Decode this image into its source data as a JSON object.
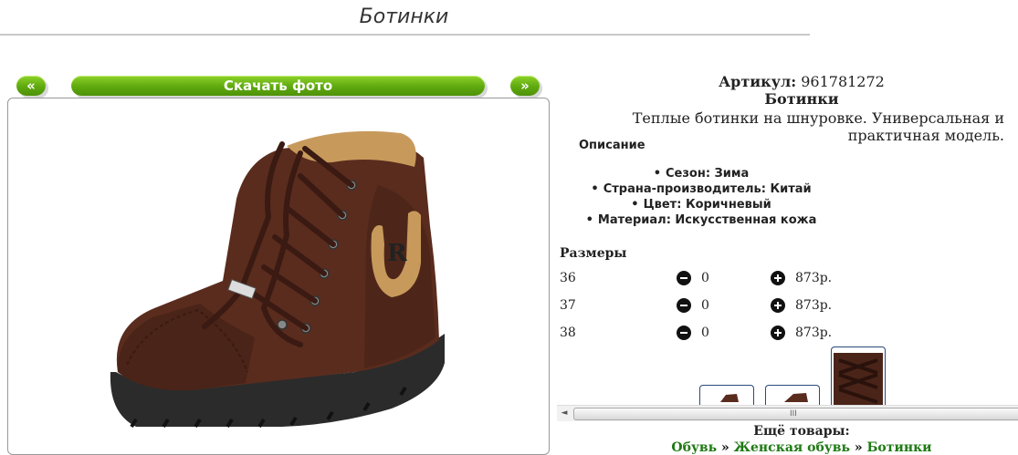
{
  "page": {
    "title": "Ботинки"
  },
  "gallery": {
    "prev_label": "«",
    "download_label": "Скачать фото",
    "next_label": "»"
  },
  "product": {
    "article_label": "Артикул:",
    "article_value": "961781272",
    "name": "Ботинки",
    "description": "Теплые ботинки на шнуровке. Универсальная и практичная модель.",
    "description_heading": "Описание",
    "properties": [
      "Сезон: Зима",
      "Страна-производитель: Китай",
      "Цвет: Коричневый",
      "Материал: Искусственная кожа"
    ]
  },
  "sizes": {
    "heading": "Размеры",
    "rows": [
      {
        "size": "36",
        "qty": "0",
        "price": "873р."
      },
      {
        "size": "37",
        "qty": "0",
        "price": "873р."
      },
      {
        "size": "38",
        "qty": "0",
        "price": "873р."
      }
    ]
  },
  "scrollbar": {
    "left_arrow": "◄",
    "grip": "III"
  },
  "more": {
    "label": "Ещё товары:",
    "crumbs": [
      "Обувь",
      "Женская обувь",
      "Ботинки"
    ],
    "separator": "»"
  },
  "colors": {
    "accent_green": "#5fa90f",
    "link_green": "#1f7a14",
    "boot_brown": "#4a2418"
  }
}
